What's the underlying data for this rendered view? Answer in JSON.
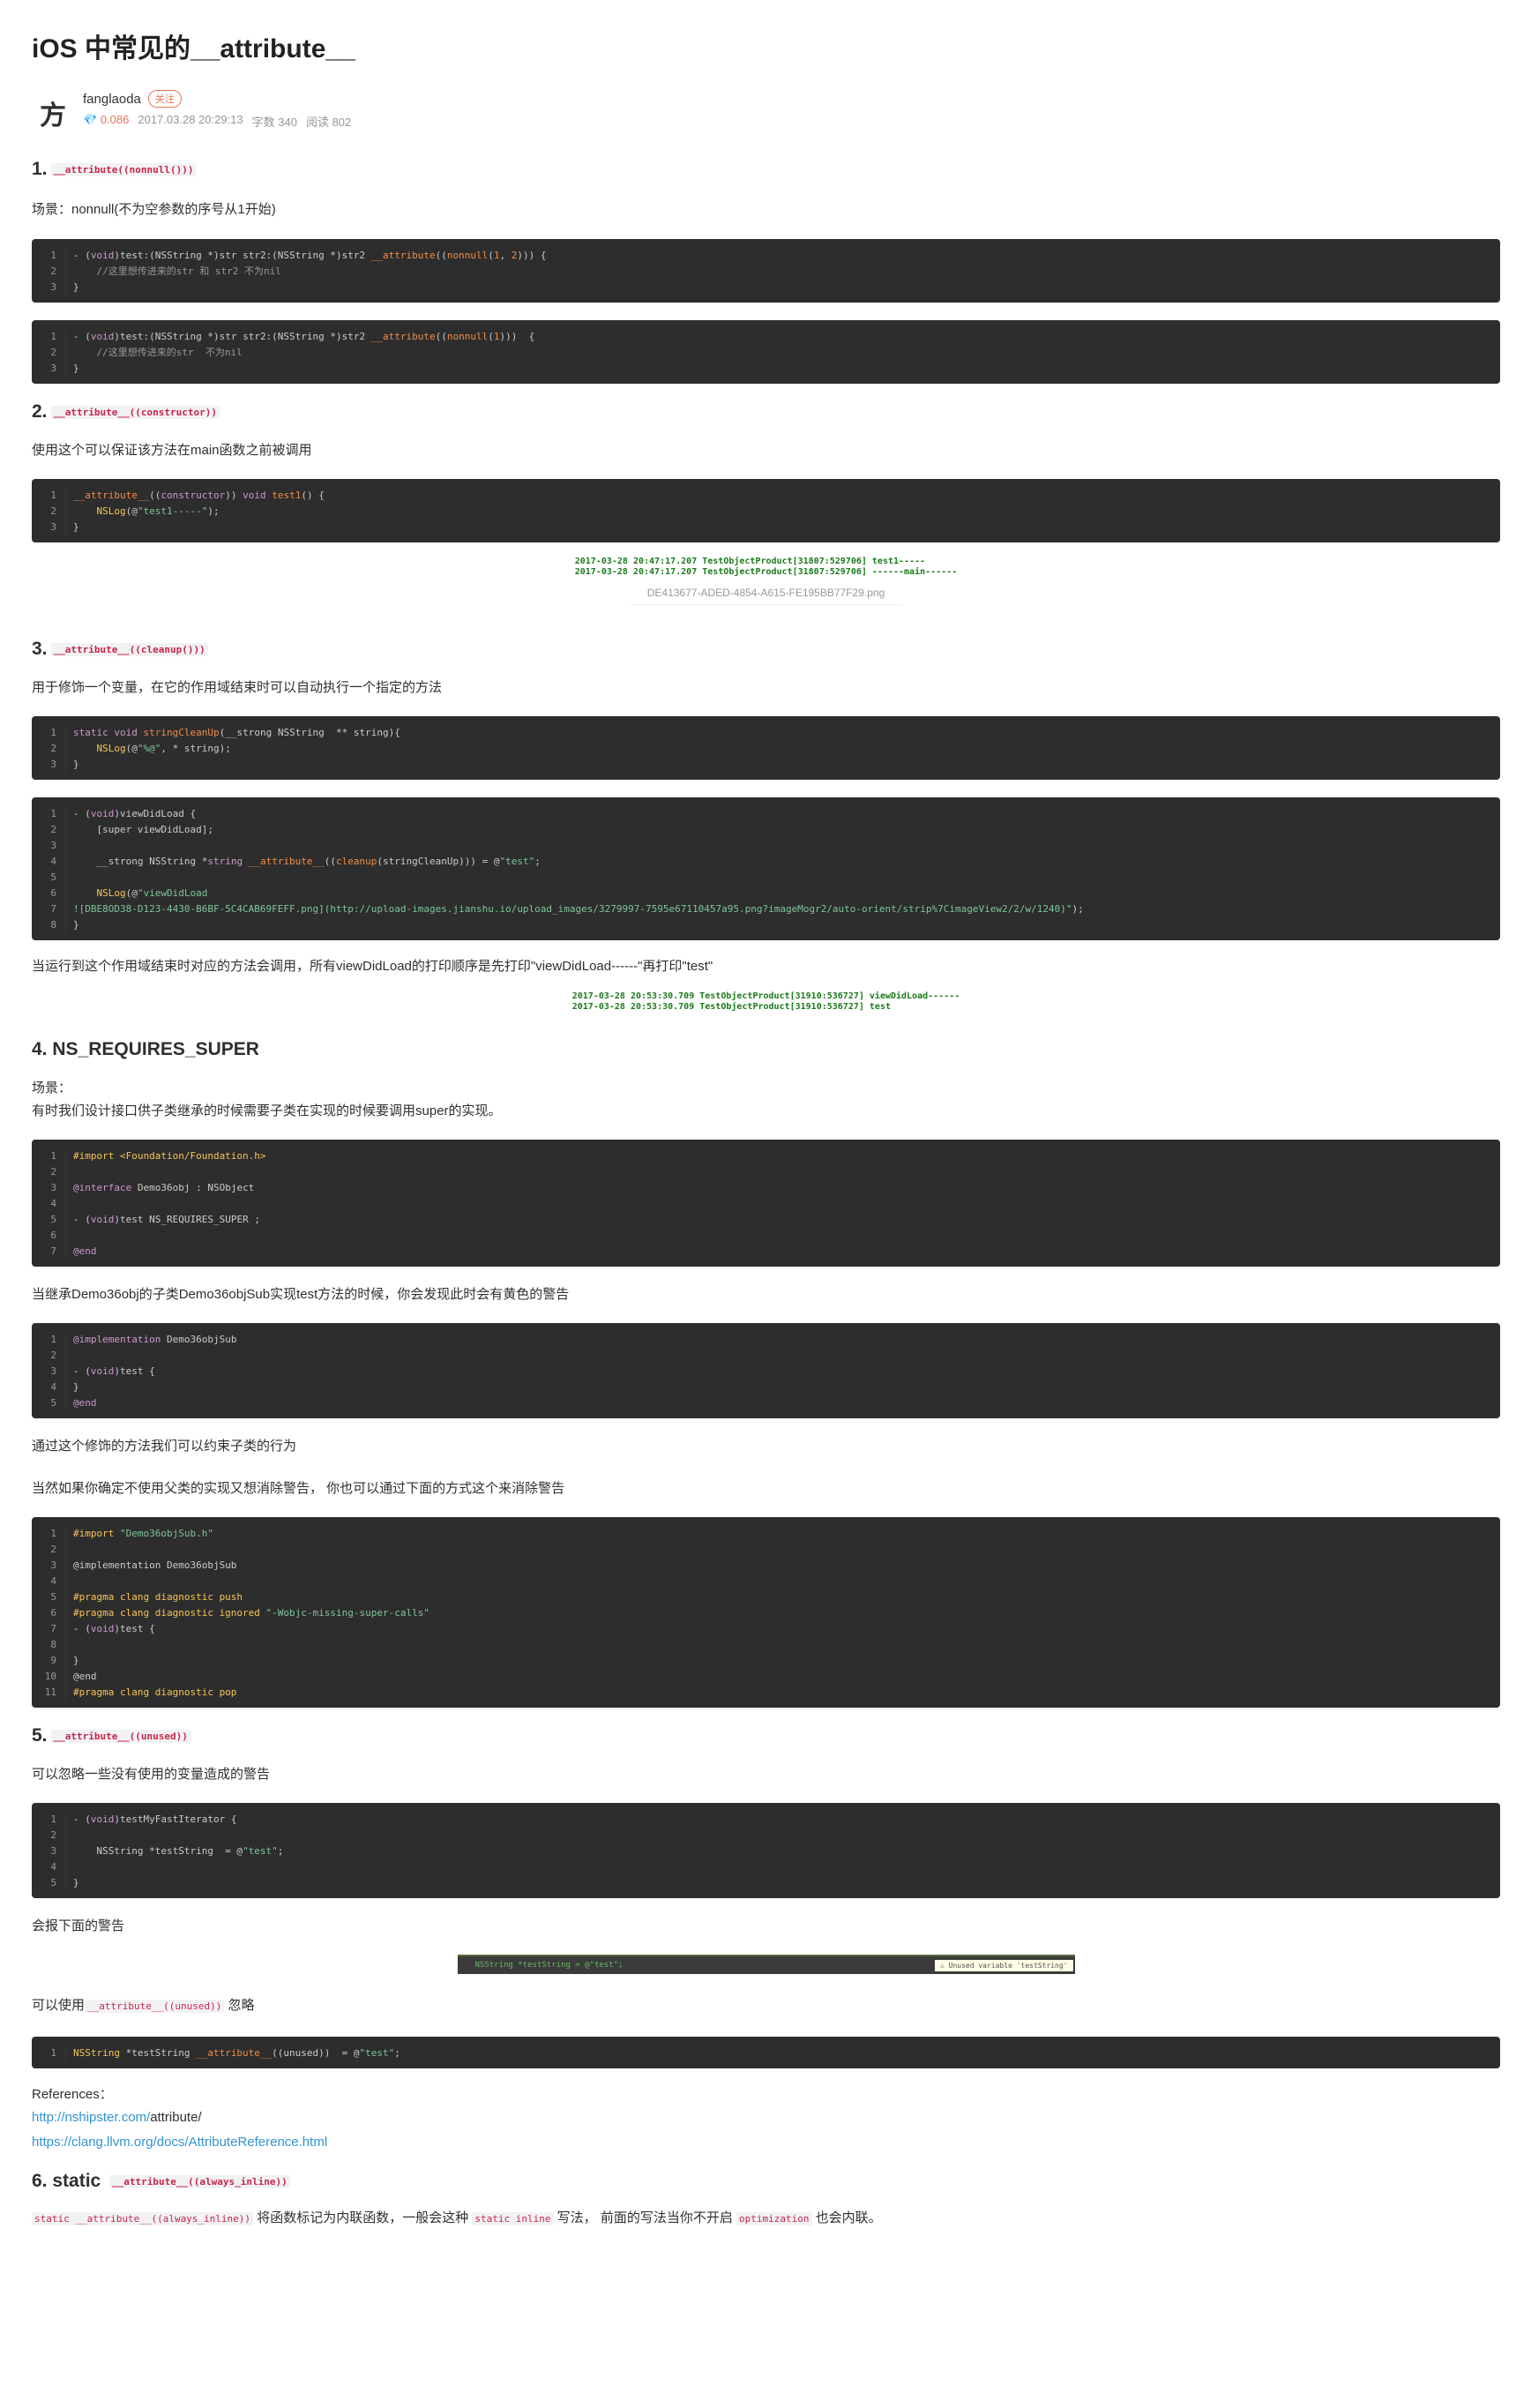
{
  "article": {
    "title": "iOS 中常见的__attribute__",
    "author": {
      "avatar_text": "方",
      "name": "fanglaoda",
      "follow_label": "关注",
      "diamond": "0.086",
      "date": "2017.03.28 20:29:13",
      "words": "字数 340",
      "reads": "阅读 802"
    }
  },
  "sections": {
    "s1": {
      "num": "1.",
      "code": "__attribute((nonnull()))",
      "desc": "场景：nonnull(不为空参数的序号从1开始)",
      "block1": [
        "1",
        "2",
        "3"
      ],
      "block2": [
        "1",
        "2",
        "3"
      ]
    },
    "s2": {
      "num": "2.",
      "code": "__attribute__((constructor))",
      "desc": "使用这个可以保证该方法在main函数之前被调用",
      "log_lines": [
        "2017-03-28 20:47:17.207 TestObjectProduct[31807:529706] test1-----",
        "2017-03-28 20:47:17.207 TestObjectProduct[31807:529706] ------main------"
      ],
      "caption": "DE413677-ADED-4854-A615-FE195BB77F29.png"
    },
    "s3": {
      "num": "3.",
      "code": "__attribute__((cleanup()))",
      "desc": "用于修饰一个变量，在它的作用域结束时可以自动执行一个指定的方法",
      "after": "当运行到这个作用域结束时对应的方法会调用，所有viewDidLoad的打印顺序是先打印\"viewDidLoad------\"再打印\"test\"",
      "log_lines": [
        "2017-03-28 20:53:30.709 TestObjectProduct[31910:536727] viewDidLoad------",
        "2017-03-28 20:53:30.709 TestObjectProduct[31910:536727] test"
      ]
    },
    "s4": {
      "title": "4. NS_REQUIRES_SUPER",
      "desc1": "场景：",
      "desc2": "有时我们设计接口供子类继承的时候需要子类在实现的时候要调用super的实现。",
      "after1": "当继承Demo36obj的子类Demo36objSub实现test方法的时候，你会发现此时会有黄色的警告",
      "after2": "通过这个修饰的方法我们可以约束子类的行为",
      "after3": "当然如果你确定不使用父类的实现又想消除警告， 你也可以通过下面的方式这个来消除警告"
    },
    "s5": {
      "num": "5.",
      "code": "__attribute__((unused))",
      "desc": "可以忽略一些没有使用的变量造成的警告",
      "after1": "会报下面的警告",
      "warn_code": "NSString *testString  = @\"test\";",
      "warn_text": "⚠ Unused variable 'testString'",
      "after2_pre": "可以使用",
      "after2_code": "__attribute__((unused))",
      "after2_post": "忽略",
      "refs_label": "References：",
      "ref1_a": "http://nshipster.com/",
      "ref1_b": "attribute/",
      "ref2": "https://clang.llvm.org/docs/AttributeReference.html"
    },
    "s6": {
      "num": "6. static",
      "code": "__attribute__((always_inline))",
      "desc_code1": "static __attribute__((always_inline))",
      "desc_text1": "将函数标记为内联函数，一般会这种",
      "desc_code2": "static inline",
      "desc_text2": "写法， 前面的写法当你不开启",
      "desc_code3": "optimization",
      "desc_text3": "也会内联。"
    }
  }
}
